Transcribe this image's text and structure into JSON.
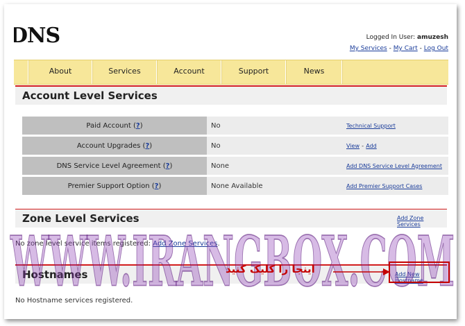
{
  "header": {
    "logo_text": "DNS",
    "login_label": "Logged In User:",
    "username": "amuzesh",
    "links": [
      "My Services",
      "My Cart",
      "Log Out"
    ],
    "sep": "-"
  },
  "nav": {
    "items": [
      "About",
      "Services",
      "Account",
      "Support",
      "News"
    ]
  },
  "account_section": {
    "title": "Account Level Services",
    "rows": [
      {
        "label": "Paid Account",
        "help": "?",
        "value": "No",
        "actions": [
          "Technical Support"
        ]
      },
      {
        "label": "Account Upgrades",
        "help": "?",
        "value": "No",
        "actions": [
          "View",
          "Add"
        ]
      },
      {
        "label": "DNS Service Level Agreement",
        "help": "?",
        "value": "None",
        "actions": [
          "Add DNS Service Level Agreement"
        ]
      },
      {
        "label": "Premier Support Option",
        "help": "?",
        "value": "None Available",
        "actions": [
          "Add Premier Support Cases"
        ]
      }
    ]
  },
  "zone_section": {
    "title": "Zone Level Services",
    "add_link": "Add Zone Services",
    "empty_text": "No zone level service items registered:",
    "empty_link": "Add Zone Services",
    "empty_suffix": "."
  },
  "hostnames_section": {
    "title": "Hostnames",
    "add_link": "Add New Hostname",
    "empty_text": "No Hostname services registered."
  },
  "overlay": {
    "annotation_text": "اینجا را کلیک کنید",
    "watermark_text": "WWW.IRANGBOX.COM",
    "accent_color": "#c40000",
    "watermark_color": "#6a1f8c"
  }
}
